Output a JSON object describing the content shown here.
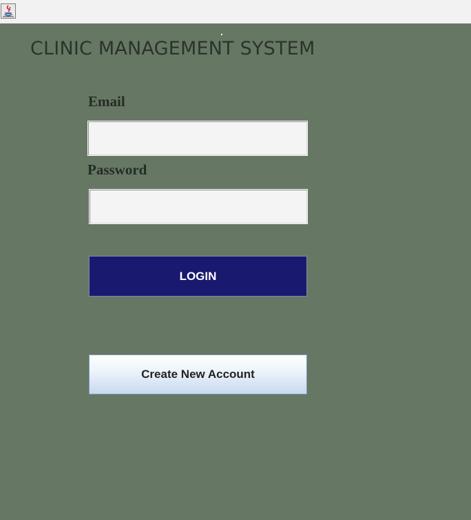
{
  "window": {
    "icon": "java-coffee-cup-icon"
  },
  "header": {
    "title": "CLINIC MANAGEMENT SYSTEM"
  },
  "login_form": {
    "email_label": "Email",
    "email_value": "",
    "email_placeholder": "",
    "password_label": "Password",
    "password_value": "",
    "password_placeholder": "",
    "login_label": "LOGIN",
    "create_account_label": "Create New Account"
  },
  "colors": {
    "background": "#667864",
    "titlebar": "#f2f2f2",
    "login_button": "#191970",
    "login_text": "#ffffff",
    "create_button": "#dfe9f6",
    "title_text": "#2c332b"
  }
}
